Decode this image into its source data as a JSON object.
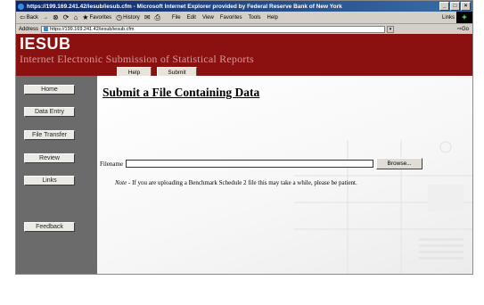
{
  "browser": {
    "title": "https://199.169.241.42/iesub/iesub.cfm - Microsoft Internet Explorer provided by Federal Reserve Bank of New York",
    "window_buttons": [
      "_",
      "□",
      "×"
    ],
    "toolbar": {
      "back": "Back",
      "forward": "→",
      "favorites": "Favorites",
      "history": "History",
      "menus": [
        "File",
        "Edit",
        "View",
        "Favorites",
        "Tools",
        "Help"
      ],
      "links": "Links"
    },
    "address": {
      "label": "Address",
      "url": "https://199.169.241.42/iesub/iesub.cfm",
      "go": "Go"
    }
  },
  "header": {
    "logo": "IESUB",
    "subtitle": "Internet Electronic Submission of Statistical Reports",
    "nav": [
      "Help",
      "Submit"
    ]
  },
  "sidebar": {
    "items": [
      "Home",
      "Data Entry",
      "File Transfer",
      "Review",
      "Links",
      "Feedback"
    ]
  },
  "main": {
    "heading": "Submit a File Containing Data",
    "file_label": "Filename",
    "file_value": "",
    "browse_label": "Browse...",
    "note_label": "Note",
    "note_text": " - If you are uploading a Benchmark Schedule 2 file this may take a while, please be patient."
  },
  "colors": {
    "header_bg": "#8b1010",
    "sidebar_bg": "#6b6b6b",
    "title_bar": "#0a246a"
  }
}
